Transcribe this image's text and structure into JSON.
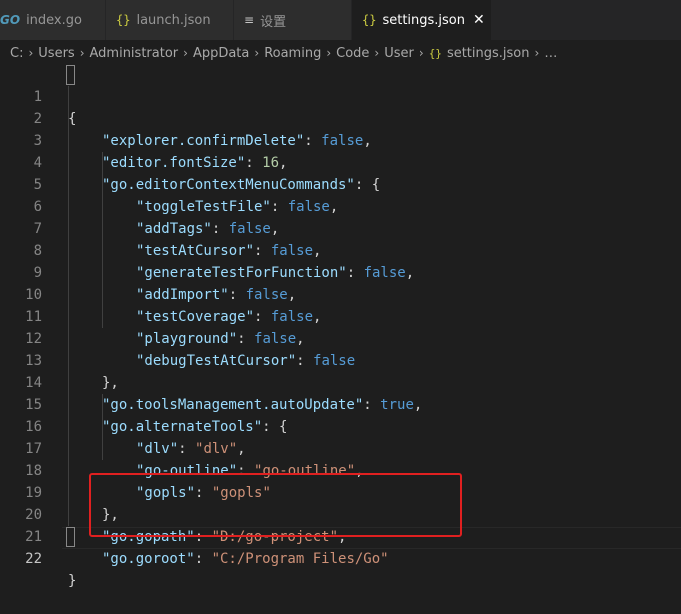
{
  "tabs": [
    {
      "icon": "GO",
      "label": "index.go",
      "active": false
    },
    {
      "icon": "{}",
      "label": "launch.json",
      "active": false
    },
    {
      "icon": "≡",
      "label": "设置",
      "active": false
    },
    {
      "icon": "{}",
      "label": "settings.json",
      "active": true,
      "close": "✕"
    }
  ],
  "breadcrumb": {
    "items": [
      "C:",
      "Users",
      "Administrator",
      "AppData",
      "Roaming",
      "Code",
      "User"
    ],
    "file_icon": "{}",
    "file": "settings.json",
    "more": "…",
    "separator": "›"
  },
  "editor": {
    "line_numbers": [
      "1",
      "2",
      "3",
      "4",
      "5",
      "6",
      "7",
      "8",
      "9",
      "10",
      "11",
      "12",
      "13",
      "14",
      "15",
      "16",
      "17",
      "18",
      "19",
      "20",
      "21",
      "22"
    ],
    "current_line": 22,
    "code": {
      "l1": {
        "p1": "{"
      },
      "l2": {
        "k": "\"explorer.confirmDelete\"",
        "p1": ": ",
        "v": "false",
        "p2": ","
      },
      "l3": {
        "k": "\"editor.fontSize\"",
        "p1": ": ",
        "v": "16",
        "p2": ","
      },
      "l4": {
        "k": "\"go.editorContextMenuCommands\"",
        "p1": ": {"
      },
      "l5": {
        "k": "\"toggleTestFile\"",
        "p1": ": ",
        "v": "false",
        "p2": ","
      },
      "l6": {
        "k": "\"addTags\"",
        "p1": ": ",
        "v": "false",
        "p2": ","
      },
      "l7": {
        "k": "\"testAtCursor\"",
        "p1": ": ",
        "v": "false",
        "p2": ","
      },
      "l8": {
        "k": "\"generateTestForFunction\"",
        "p1": ": ",
        "v": "false",
        "p2": ","
      },
      "l9": {
        "k": "\"addImport\"",
        "p1": ": ",
        "v": "false",
        "p2": ","
      },
      "l10": {
        "k": "\"testCoverage\"",
        "p1": ": ",
        "v": "false",
        "p2": ","
      },
      "l11": {
        "k": "\"playground\"",
        "p1": ": ",
        "v": "false",
        "p2": ","
      },
      "l12": {
        "k": "\"debugTestAtCursor\"",
        "p1": ": ",
        "v": "false"
      },
      "l13": {
        "p1": "},"
      },
      "l14": {
        "k": "\"go.toolsManagement.autoUpdate\"",
        "p1": ": ",
        "v": "true",
        "p2": ","
      },
      "l15": {
        "k": "\"go.alternateTools\"",
        "p1": ": {"
      },
      "l16": {
        "k": "\"dlv\"",
        "p1": ": ",
        "v": "\"dlv\"",
        "p2": ","
      },
      "l17": {
        "k": "\"go-outline\"",
        "p1": ": ",
        "v": "\"go-outline\"",
        "p2": ","
      },
      "l18": {
        "k": "\"gopls\"",
        "p1": ": ",
        "v": "\"gopls\""
      },
      "l19": {
        "p1": "},"
      },
      "l20": {
        "k": "\"go.gopath\"",
        "p1": ": ",
        "v": "\"D:/go-project\"",
        "p2": ","
      },
      "l21": {
        "k": "\"go.goroot\"",
        "p1": ": ",
        "v": "\"C:/Program Files/Go\""
      },
      "l22": {
        "p1": "}"
      }
    }
  },
  "colors": {
    "background": "#1e1e1e",
    "key": "#9cdcfe",
    "string": "#ce9178",
    "boolean": "#569cd6",
    "number": "#b5cea8",
    "highlight_box": "#e02020"
  }
}
